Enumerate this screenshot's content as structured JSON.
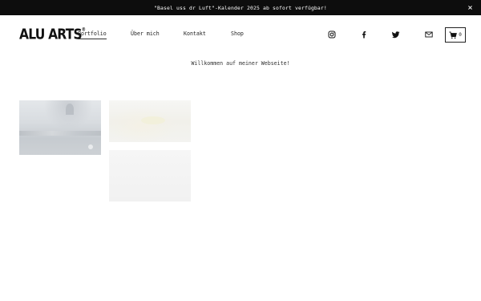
{
  "announcement": {
    "text": "\"Basel uss dr Luft\"-Kalender 2025 ab sofort verfügbar!",
    "close_icon": "close-icon"
  },
  "header": {
    "logo_text": "ALU ARTS",
    "logo_mark": "®",
    "nav": {
      "portfolio": "Portfolio",
      "about": "Über mich",
      "contact": "Kontakt",
      "shop": "Shop"
    },
    "social_icons": [
      "instagram-icon",
      "facebook-icon",
      "twitter-icon",
      "mail-icon"
    ],
    "cart": {
      "icon": "cart-icon",
      "count": "0"
    }
  },
  "main": {
    "welcome": "Willkommen auf meiner Webseite!",
    "gallery": [
      {
        "name": "gallery-image-1"
      },
      {
        "name": "gallery-image-2"
      },
      {
        "name": "gallery-image-3"
      }
    ]
  },
  "colors": {
    "announcement_bg": "#0d0d0d",
    "text": "#111111",
    "background": "#ffffff"
  }
}
